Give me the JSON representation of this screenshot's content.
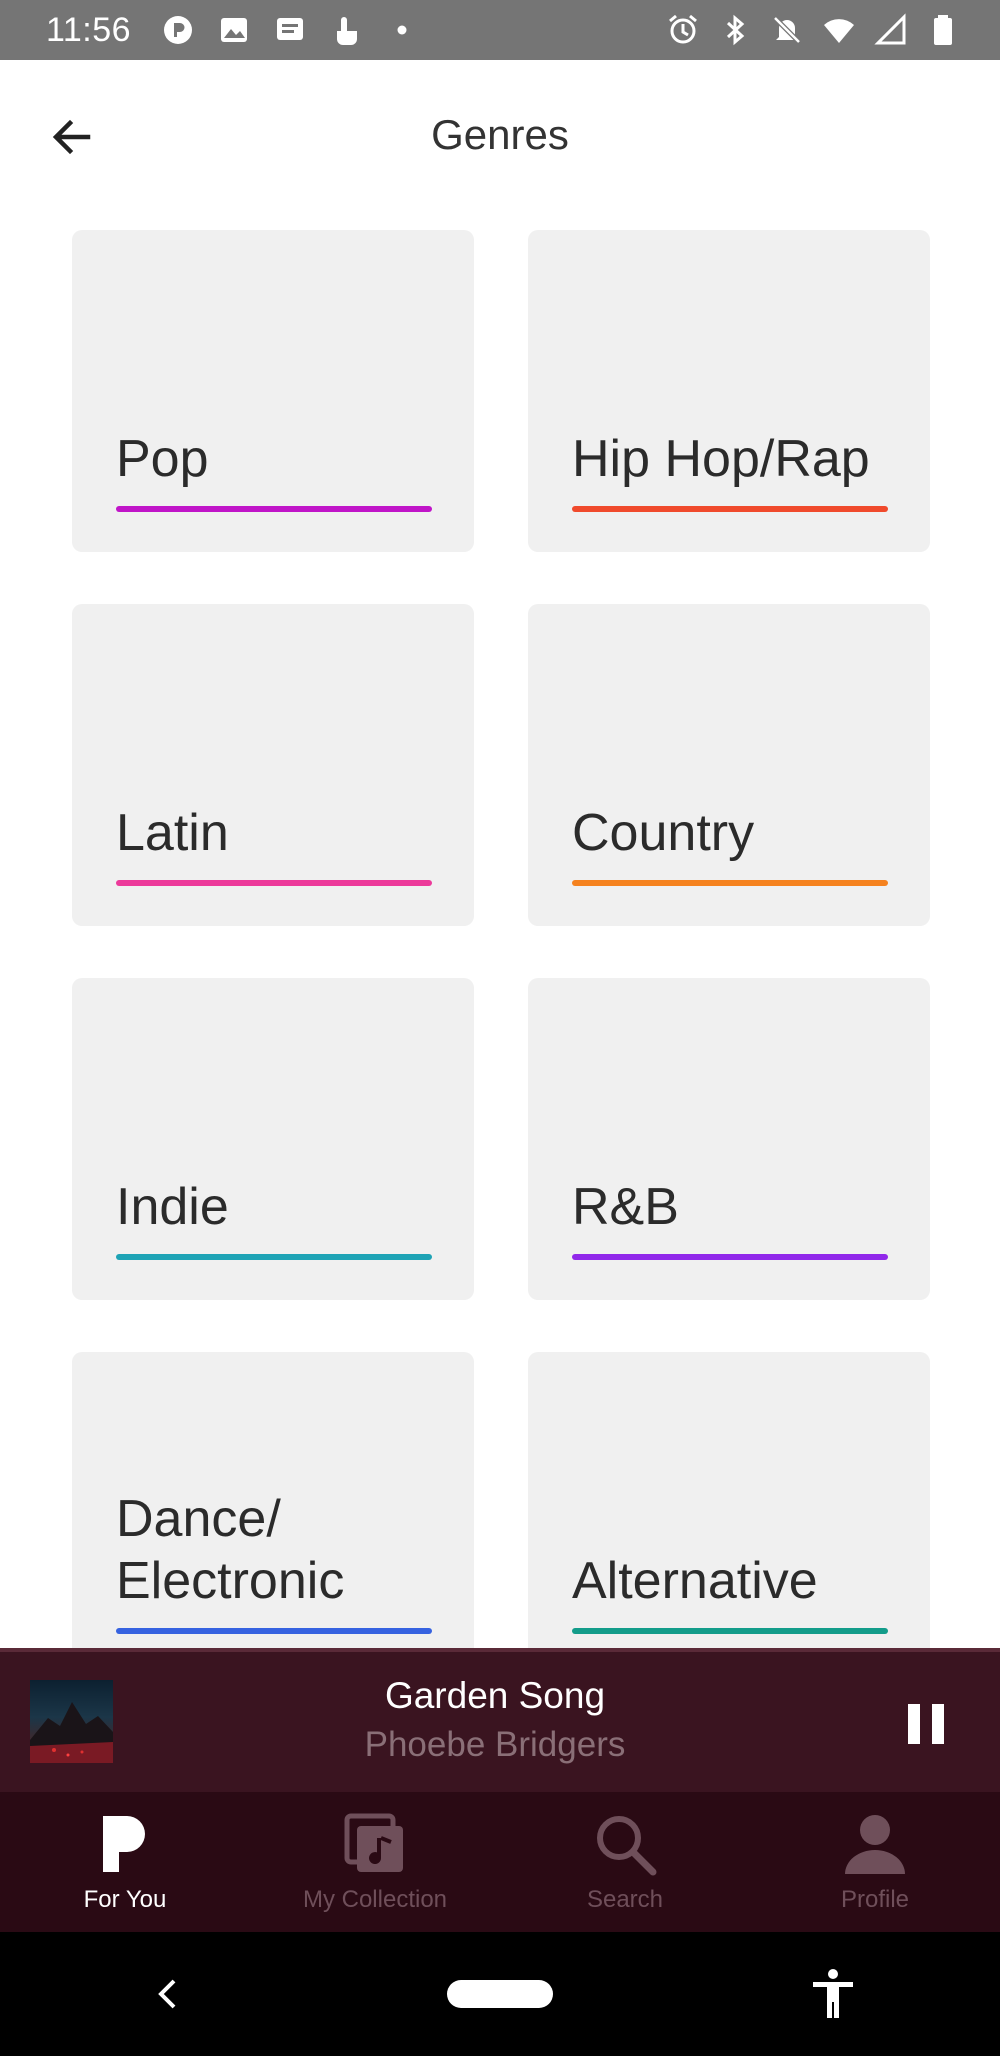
{
  "status_bar": {
    "time": "11:56",
    "left_icons": [
      "pandora-notification-icon",
      "image-notification-icon",
      "message-notification-icon",
      "touch-notification-icon",
      "dot-icon"
    ],
    "right_icons": [
      "alarm-icon",
      "bluetooth-icon",
      "notifications-off-icon",
      "wifi-icon",
      "signal-icon",
      "battery-icon"
    ]
  },
  "header": {
    "title": "Genres",
    "back_icon": "arrow-left-icon"
  },
  "genres": [
    {
      "label": "Pop",
      "color": "#c015c8"
    },
    {
      "label": "Hip Hop/Rap",
      "color": "#f04a2c"
    },
    {
      "label": "Latin",
      "color": "#ec3a9a"
    },
    {
      "label": "Country",
      "color": "#f5821f"
    },
    {
      "label": "Indie",
      "color": "#1ea3b5"
    },
    {
      "label": "R&B",
      "color": "#9128ea"
    },
    {
      "label": "Dance/\nElectronic",
      "color": "#3662e0"
    },
    {
      "label": "Alternative",
      "color": "#139c8a"
    }
  ],
  "now_playing": {
    "title": "Garden Song",
    "artist": "Phoebe Bridgers",
    "control_icon": "pause-icon"
  },
  "bottom_nav": {
    "items": [
      {
        "label": "For You",
        "icon": "pandora-p-icon",
        "active": true
      },
      {
        "label": "My Collection",
        "icon": "collection-icon",
        "active": false
      },
      {
        "label": "Search",
        "icon": "search-icon",
        "active": false
      },
      {
        "label": "Profile",
        "icon": "profile-icon",
        "active": false
      }
    ]
  },
  "system_nav": {
    "icons": [
      "back-chevron-icon",
      "home-pill-icon",
      "accessibility-icon"
    ]
  },
  "colors": {
    "status_bar": "#757575",
    "card_bg": "#f0f0f0",
    "now_playing_bg": "#3a1420",
    "bottom_nav_bg": "#2a0a14",
    "nav_active": "#ffffff",
    "nav_inactive": "#6f4f5a"
  }
}
